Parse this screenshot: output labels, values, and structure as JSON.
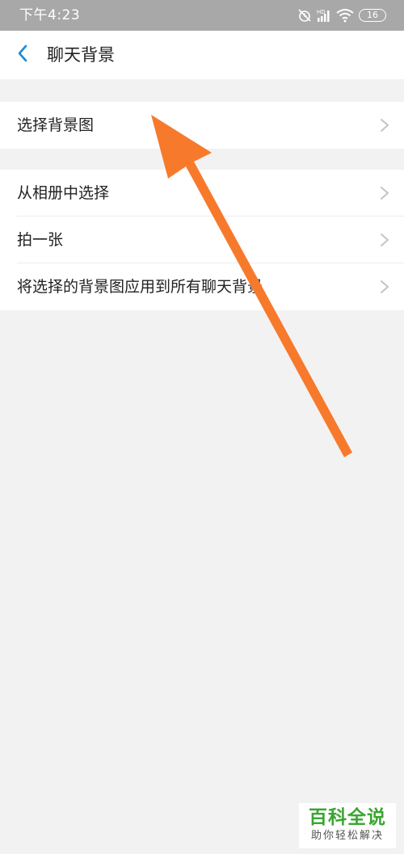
{
  "status_bar": {
    "time": "下午4:23",
    "battery": "16",
    "icons": [
      "alarm-off-icon",
      "hd-signal-icon",
      "wifi-icon",
      "battery-icon"
    ]
  },
  "header": {
    "back_icon": "chevron-left-icon",
    "title": "聊天背景"
  },
  "sections": [
    {
      "items": [
        {
          "label": "选择背景图",
          "icon": "chevron-right-icon"
        }
      ]
    },
    {
      "items": [
        {
          "label": "从相册中选择",
          "icon": "chevron-right-icon"
        },
        {
          "label": "拍一张",
          "icon": "chevron-right-icon"
        },
        {
          "label": "将选择的背景图应用到所有聊天背景",
          "icon": "chevron-right-icon"
        }
      ]
    }
  ],
  "annotation": {
    "arrow_color": "#f77a2c",
    "icon": "pointer-arrow"
  },
  "watermark": {
    "main": "百科全说",
    "sub": "助你轻松解决",
    "color": "#3aa532"
  },
  "colors": {
    "accent": "#1a8ccf",
    "background": "#f2f2f2",
    "status_bar": "#a8a8a8"
  }
}
